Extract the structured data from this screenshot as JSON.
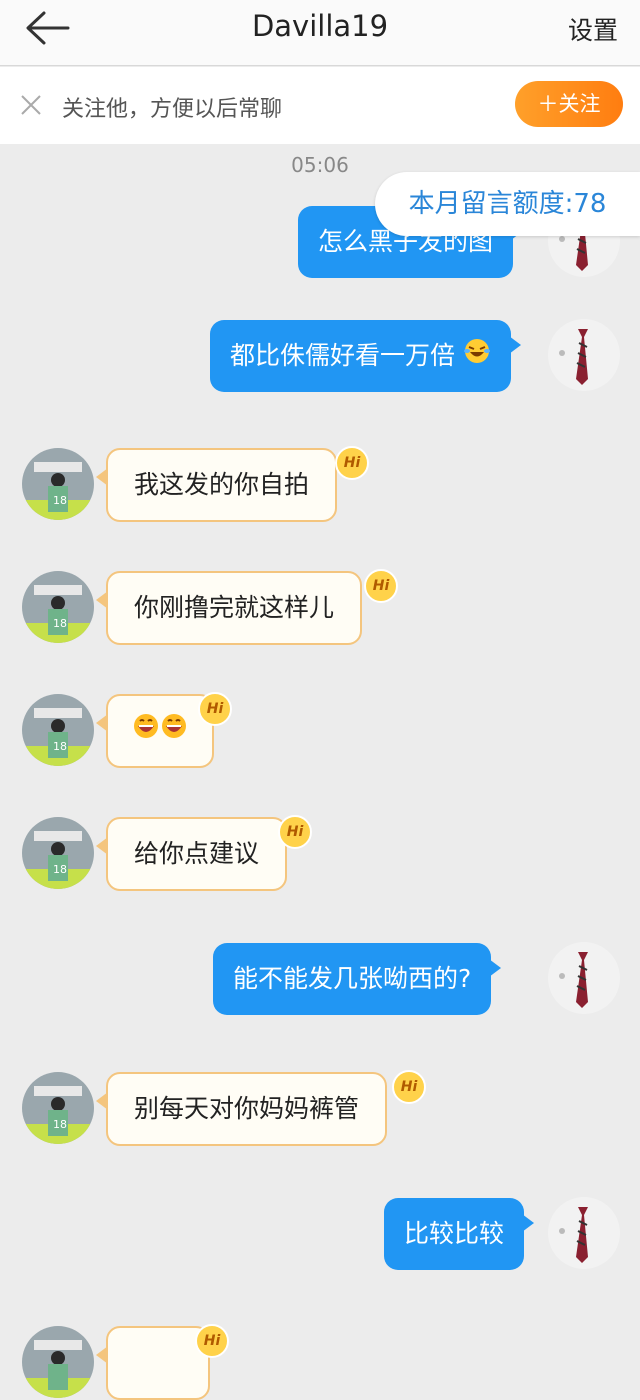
{
  "header": {
    "title": "Davilla19",
    "settings_label": "设置"
  },
  "follow_bar": {
    "text": "关注他，方便以后常聊",
    "button_label": "＋关注"
  },
  "chat": {
    "timestamp": "05:06",
    "quota_label": "本月留言额度:78",
    "messages": [
      {
        "side": "out",
        "text": "怎么黑子发的图"
      },
      {
        "side": "out",
        "text": "都比侏儒好看一万倍",
        "emoji": "laugh-cry-emoji"
      },
      {
        "side": "in",
        "text": "我这发的你自拍",
        "badge": "Hi"
      },
      {
        "side": "in",
        "text": "你刚撸完就这样儿",
        "badge": "Hi"
      },
      {
        "side": "in",
        "text": "",
        "emoji": "grin-emoji x2",
        "badge": "Hi"
      },
      {
        "side": "in",
        "text": "给你点建议",
        "badge": "Hi"
      },
      {
        "side": "out",
        "text": "能不能发几张呦西的?"
      },
      {
        "side": "in",
        "text": "别每天对你妈妈裤管",
        "badge": "Hi"
      },
      {
        "side": "out",
        "text": "比较比较"
      },
      {
        "side": "in",
        "text": "",
        "badge": "Hi"
      }
    ]
  },
  "colors": {
    "outgoing_bubble": "#2196f3",
    "incoming_border": "#f4c57e",
    "follow_button": "#ff8c1a",
    "quota_text": "#2a86d8"
  }
}
